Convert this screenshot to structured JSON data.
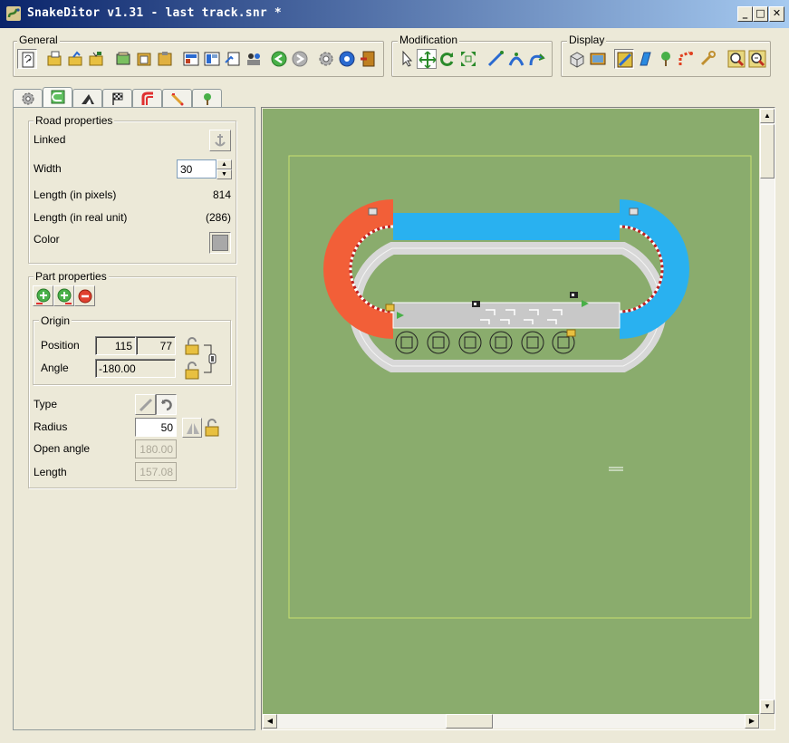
{
  "window": {
    "title": "SnakeDitor v1.31 - last track.snr *",
    "buttons": {
      "minimize": "_",
      "maximize": "□",
      "close": "✕"
    }
  },
  "toolbar": {
    "general_label": "General",
    "modification_label": "Modification",
    "display_label": "Display"
  },
  "tabs": [
    "gear-icon",
    "road-icon",
    "slope-icon",
    "checkered-flag-icon",
    "corner-icon",
    "ruler-icon",
    "tree-icon"
  ],
  "road_properties": {
    "legend": "Road properties",
    "linked_label": "Linked",
    "width_label": "Width",
    "width_value": "30",
    "length_pixels_label": "Length (in pixels)",
    "length_pixels_value": "814",
    "length_real_label": "Length (in real unit)",
    "length_real_value": "(286)",
    "color_label": "Color",
    "color_value": "#a8a8a8"
  },
  "part_properties": {
    "legend": "Part properties",
    "origin_legend": "Origin",
    "position_label": "Position",
    "position_x": "115",
    "position_y": "77",
    "angle_label": "Angle",
    "angle_value": "-180.00",
    "type_label": "Type",
    "radius_label": "Radius",
    "radius_value": "50",
    "open_angle_label": "Open angle",
    "open_angle_value": "180.00",
    "length_label": "Length",
    "length_value": "157.08"
  },
  "colors": {
    "canvas_bg": "#8aac6d",
    "road_gray": "#c8c8c8",
    "segment_red": "#f25f38",
    "segment_blue": "#29b1f0"
  }
}
